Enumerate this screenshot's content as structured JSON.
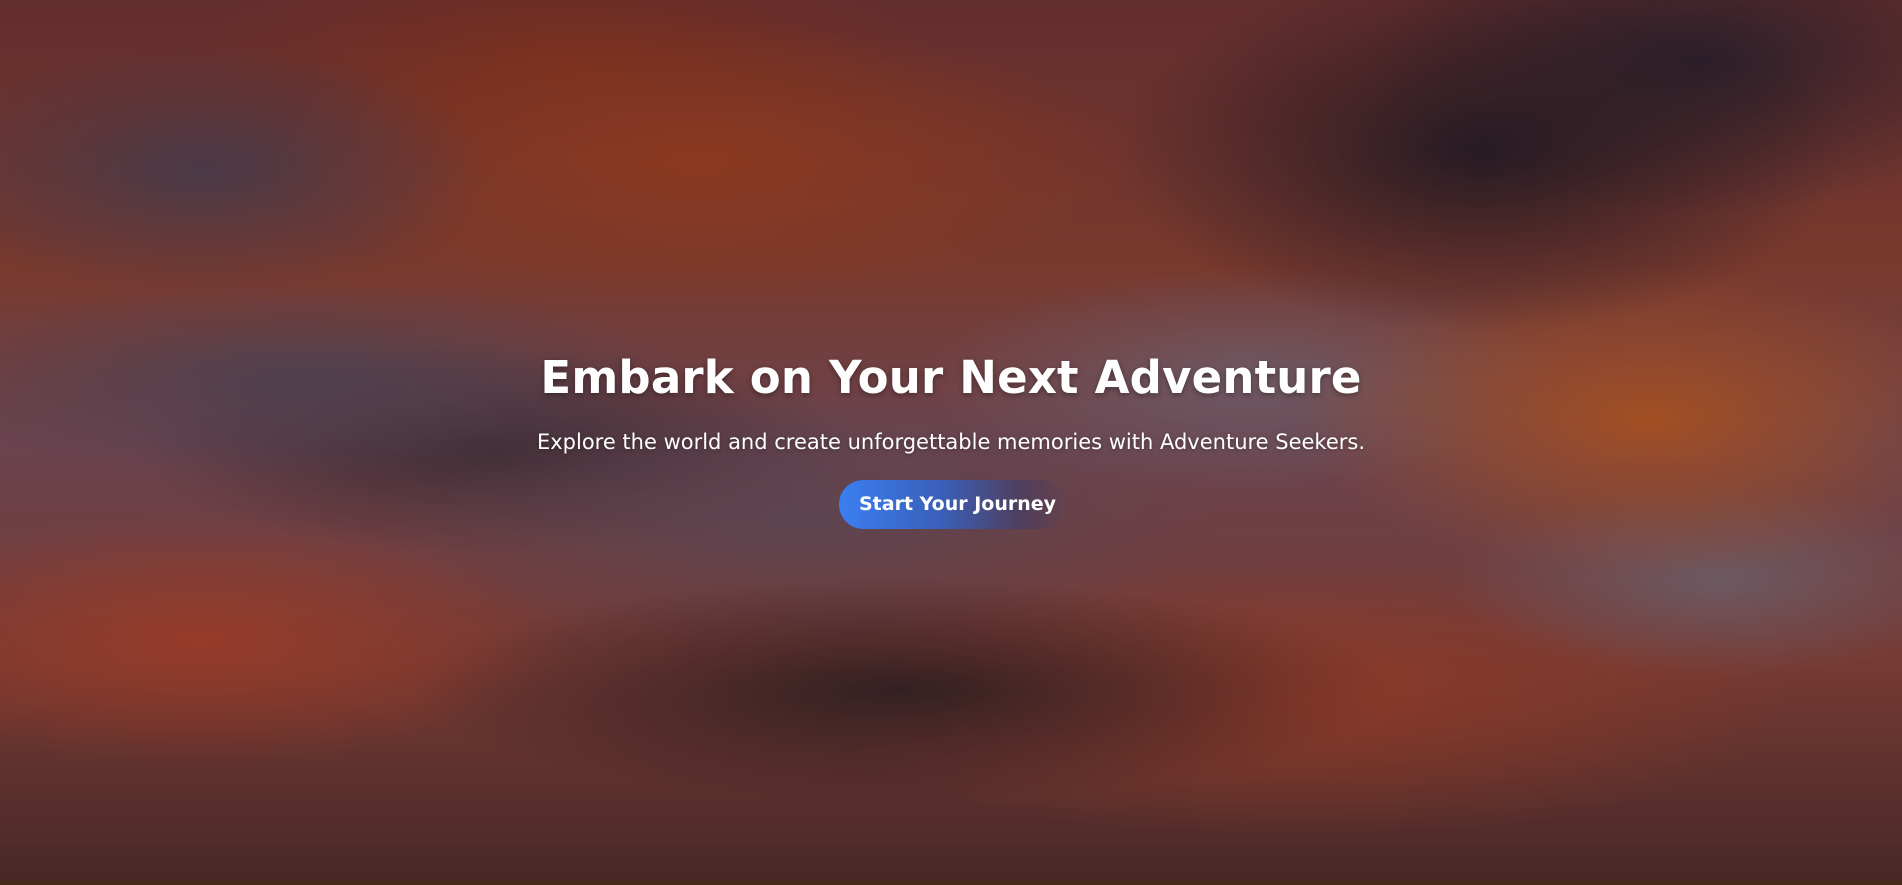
{
  "hero": {
    "title": "Embark on Your Next Adventure",
    "subtitle": "Explore the world and create unforgettable memories with Adventure Seekers.",
    "cta_label": "Start Your Journey",
    "background": "blurred-sunset-sky-image"
  },
  "colors": {
    "text": "#ffffff",
    "button_start": "#3b7ff2",
    "button_end": "#3a5fb8"
  }
}
